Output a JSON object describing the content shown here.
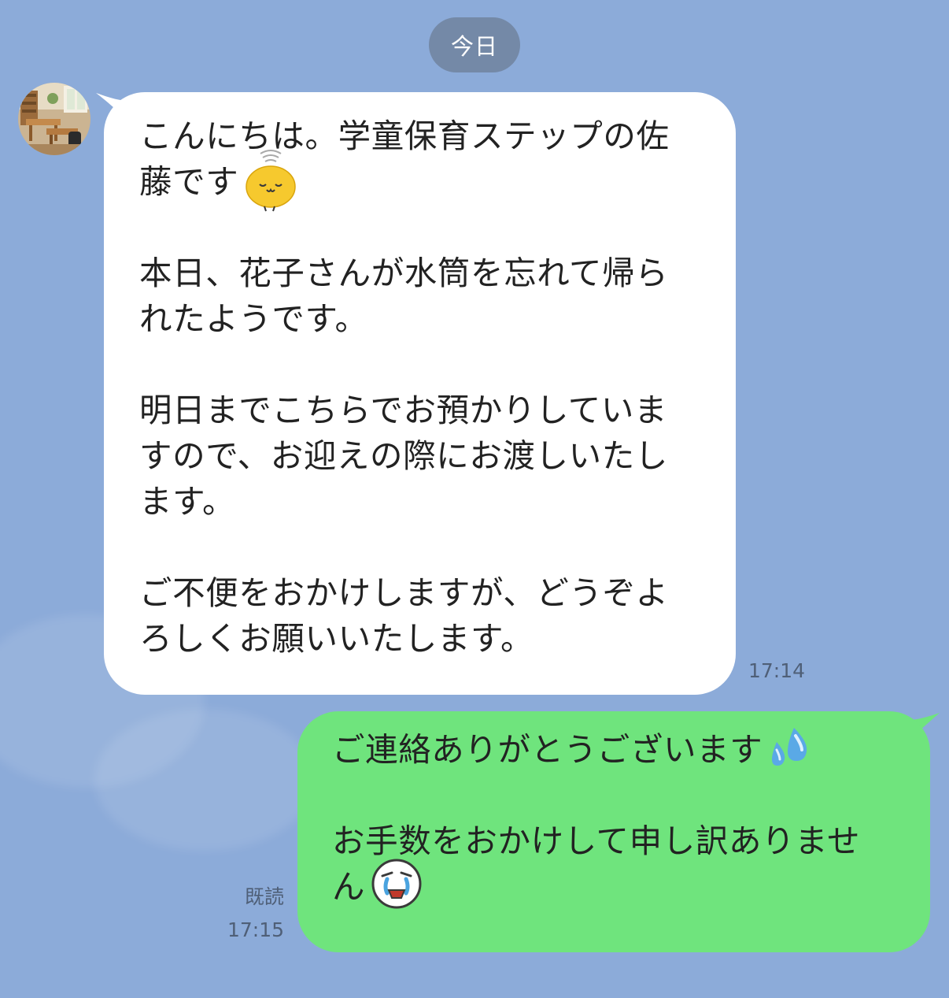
{
  "chat": {
    "date_separator": "今日",
    "incoming": {
      "avatar_icon": "classroom-photo-avatar",
      "lines": [
        "こんにちは。学童保育ステップの佐",
        "藤です",
        "",
        "本日、花子さんが水筒を忘れて帰ら",
        "れたようです。",
        "",
        "明日までこちらでお預かりしていま",
        "すので、お迎えの際にお渡しいたし",
        "ます。",
        "",
        "ご不便をおかけしますが、どうぞよ",
        "ろしくお願いいたします。"
      ],
      "emoji_icon": "bowing-chick-icon",
      "time": "17:14"
    },
    "outgoing": {
      "lines": [
        "ご連絡ありがとうございます",
        "",
        "お手数をおかけして申し訳ありませ",
        "ん"
      ],
      "emoji_icons": [
        "sweat-droplets-icon",
        "crying-face-icon"
      ],
      "read_label": "既読",
      "time": "17:15"
    },
    "colors": {
      "background": "#8cabd9",
      "incoming_bubble": "#ffffff",
      "outgoing_bubble": "#6fe47d",
      "date_pill": "#7489a7"
    }
  }
}
